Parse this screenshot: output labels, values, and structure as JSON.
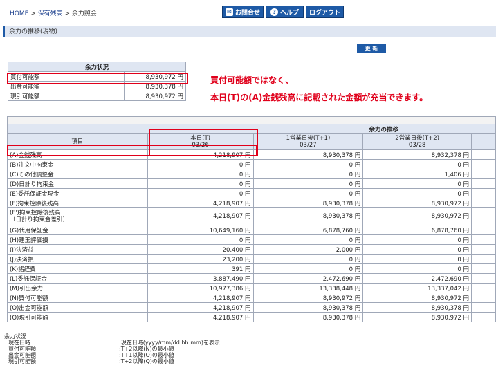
{
  "breadcrumb": {
    "home": "HOME",
    "sep1": ">",
    "holdings": "保有残高",
    "sep2": ">",
    "current": "余力照会"
  },
  "header_buttons": {
    "contact": "お問合せ",
    "help": "ヘルプ",
    "logout": "ログアウト",
    "help_glyph": "?"
  },
  "section_title": "余力の推移(現物)",
  "refresh_label": "更 新",
  "yoryoku_status": {
    "title": "余力状況",
    "rows": [
      {
        "label": "買付可能額",
        "value": "8,930,972 円"
      },
      {
        "label": "出金可能額",
        "value": "8,930,378 円"
      },
      {
        "label": "現引可能額",
        "value": "8,930,972 円"
      }
    ]
  },
  "annotation": {
    "line1": "買付可能額ではなく、",
    "line2": "本日(T)の(A)金銭残高に記載された金額が充当できます。"
  },
  "transition_table": {
    "title": "余力の推移",
    "item_header": "項目",
    "columns": [
      {
        "label": "本日(T)",
        "date": "03/26"
      },
      {
        "label": "1営業日後(T+1)",
        "date": "03/27"
      },
      {
        "label": "2営業日後(T+2)",
        "date": "03/28"
      }
    ],
    "rows": [
      {
        "label": "(A)金銭残高",
        "values": [
          "4,218,907 円",
          "8,930,378 円",
          "8,932,378 円"
        ]
      },
      {
        "label": "(B)注文中拘束金",
        "values": [
          "0 円",
          "0 円",
          "0 円"
        ]
      },
      {
        "label": "(C)その他調整金",
        "values": [
          "0 円",
          "0 円",
          "1,406 円"
        ]
      },
      {
        "label": "(D)日計り拘束金",
        "values": [
          "0 円",
          "0 円",
          "0 円"
        ]
      },
      {
        "label": "(E)委託保証金現金",
        "values": [
          "0 円",
          "0 円",
          "0 円"
        ]
      },
      {
        "label": "(F)拘束控除後残高",
        "values": [
          "4,218,907 円",
          "8,930,378 円",
          "8,930,972 円"
        ]
      },
      {
        "label": "(F')拘束控除後残高",
        "label2": "（日計り拘束金差引）",
        "values": [
          "4,218,907 円",
          "8,930,378 円",
          "8,930,972 円"
        ]
      },
      {
        "label": "(G)代用保証金",
        "values": [
          "10,649,160 円",
          "6,878,760 円",
          "6,878,760 円"
        ]
      },
      {
        "label": "(H)建玉評価損",
        "values": [
          "0 円",
          "0 円",
          "0 円"
        ]
      },
      {
        "label": "(I)決済益",
        "values": [
          "20,400 円",
          "2,000 円",
          "0 円"
        ]
      },
      {
        "label": "(J)決済損",
        "values": [
          "23,200 円",
          "0 円",
          "0 円"
        ]
      },
      {
        "label": "(K)諸経費",
        "values": [
          "391 円",
          "0 円",
          "0 円"
        ]
      },
      {
        "label": "(L)委託保証金",
        "values": [
          "3,887,490 円",
          "2,472,690 円",
          "2,472,690 円"
        ]
      },
      {
        "label": "(M)引出余力",
        "values": [
          "10,977,386 円",
          "13,338,448 円",
          "13,337,042 円"
        ]
      },
      {
        "label": "(N)買付可能額",
        "values": [
          "4,218,907 円",
          "8,930,972 円",
          "8,930,972 円"
        ]
      },
      {
        "label": "(O)出金可能額",
        "values": [
          "4,218,907 円",
          "8,930,378 円",
          "8,930,378 円"
        ]
      },
      {
        "label": "(Q)現引可能額",
        "values": [
          "4,218,907 円",
          "8,930,378 円",
          "8,930,972 円"
        ]
      }
    ]
  },
  "footnotes": {
    "title": "余力状況",
    "rows": [
      {
        "key": "現在日時",
        "desc": ":現在日時(yyyy/mm/dd hh:mm)を表示"
      },
      {
        "key": "買付可能額",
        "desc": ":T+2以降(N)の最小値"
      },
      {
        "key": "出金可能額",
        "desc": ":T+1以降(O)の最小値"
      },
      {
        "key": "現引可能額",
        "desc": ":T+2以降(Q)の最小値"
      }
    ]
  },
  "colors": {
    "accent": "#1e5aa6",
    "highlight": "#e0001b",
    "header_bg": "#dfe6f2"
  },
  "icons": {
    "contact": "mail-icon",
    "help": "question-icon"
  }
}
